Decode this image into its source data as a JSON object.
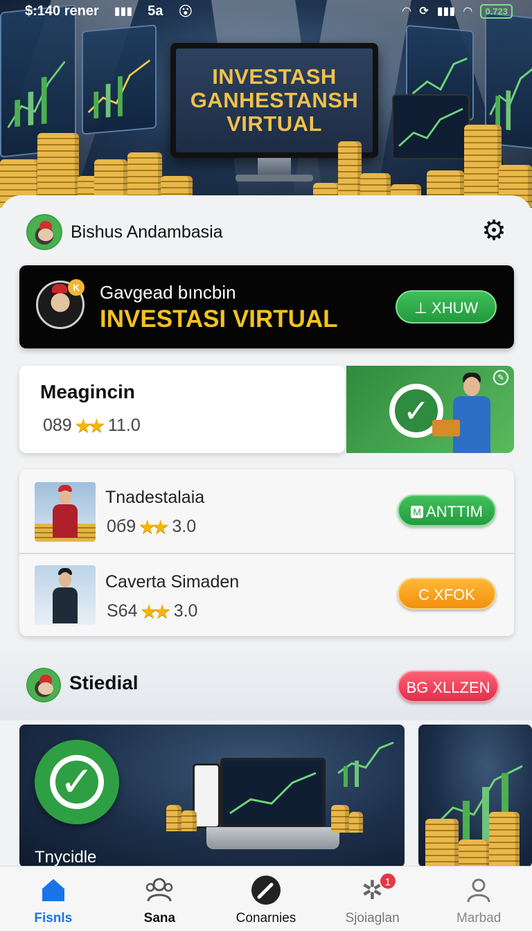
{
  "status_bar": {
    "left_text": "$:140 rener",
    "time": "5a",
    "battery": "0.723",
    "emoji": "😮"
  },
  "hero": {
    "monitor_lines": [
      "INVESTASH",
      "GANHESTANSH",
      "VIRTUAL"
    ]
  },
  "profile": {
    "name": "Bishus Andambasia"
  },
  "banner": {
    "subtitle": "Gavgead bıncbin",
    "title": "INVESTASI VIRTUAL",
    "badge": "K",
    "button_label": "⊥ XHUW"
  },
  "feature": {
    "title": "Meagincin",
    "rating_prefix": "089",
    "stars": "★★",
    "rating_value": "11.0"
  },
  "list": [
    {
      "title": "Tnadestalaia",
      "prefix": "0б9",
      "stars": "★★",
      "value": "3.0",
      "button_label": "ANTTIM",
      "button_icon": "M"
    },
    {
      "title": "Caverta Simaden",
      "prefix": "S64",
      "stars": "★★",
      "value": "3.0",
      "button_label": "C XFOK",
      "button_icon": ""
    }
  ],
  "section": {
    "title": "Stiedial",
    "button_label": "BG XLLZEN"
  },
  "tiles": {
    "first_label": "Tnycidle"
  },
  "bottom_nav": [
    {
      "label": "Fisnls",
      "icon": "home-icon",
      "active": true
    },
    {
      "label": "Sana",
      "icon": "users-icon",
      "active": false
    },
    {
      "label": "Conarnies",
      "icon": "pencil-icon",
      "active": false
    },
    {
      "label": "Sjoiaglan",
      "icon": "gear-icon",
      "active": false,
      "badge": "1"
    },
    {
      "label": "Marbad",
      "icon": "user-icon",
      "active": false
    }
  ],
  "colors": {
    "accent_green": "#2ea043",
    "accent_gold": "#f4c21f",
    "nav_active": "#1a73e8",
    "badge_red": "#e53945"
  }
}
